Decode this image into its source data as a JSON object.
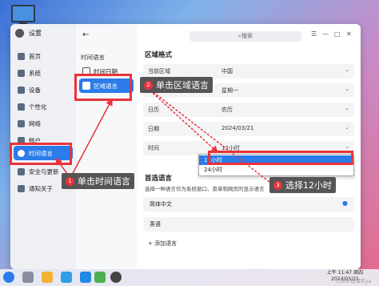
{
  "sidebar": {
    "title": "设置",
    "items": [
      {
        "label": "首页"
      },
      {
        "label": "系统"
      },
      {
        "label": "设备"
      },
      {
        "label": "个性化"
      },
      {
        "label": "网络"
      },
      {
        "label": "帐户"
      },
      {
        "label": "时间语言"
      },
      {
        "label": "安全与更新"
      },
      {
        "label": "通知关于"
      }
    ]
  },
  "middle": {
    "back": "←",
    "heading": "时间语言",
    "items": [
      {
        "label": "时间日期"
      },
      {
        "label": "区域语言"
      }
    ]
  },
  "header": {
    "search_placeholder": "⌕搜索",
    "menu": "☰",
    "minimize": "—",
    "maximize": "□",
    "close": "✕"
  },
  "region_format": {
    "title": "区域格式",
    "rows": [
      {
        "label": "当前区域",
        "value": "中国"
      },
      {
        "label": "一周第一天",
        "value": "星期一"
      },
      {
        "label": "日历",
        "value": "农历"
      },
      {
        "label": "日期",
        "value": "2024/03/21"
      },
      {
        "label": "时间",
        "value": "12小时"
      }
    ],
    "time_options": [
      "12小时",
      "24小时"
    ]
  },
  "language": {
    "title": "首选语言",
    "desc": "选择一种语言作为系统窗口、菜单和网页的显示语言",
    "items": [
      {
        "label": "简体中文",
        "selected": true
      },
      {
        "label": "英语"
      }
    ],
    "add": "+ 添加语言"
  },
  "annotations": {
    "step1": {
      "num": "1",
      "text": "单击时间语言"
    },
    "step2": {
      "num": "2",
      "text": "单击区域语言"
    },
    "step3": {
      "num": "3",
      "text": "选择12小时"
    },
    "color": "#e8333a"
  },
  "taskbar": {
    "time": "上午 11:47 周四",
    "date": "2024/03/21"
  },
  "watermark": "CSDN @清欢ya"
}
